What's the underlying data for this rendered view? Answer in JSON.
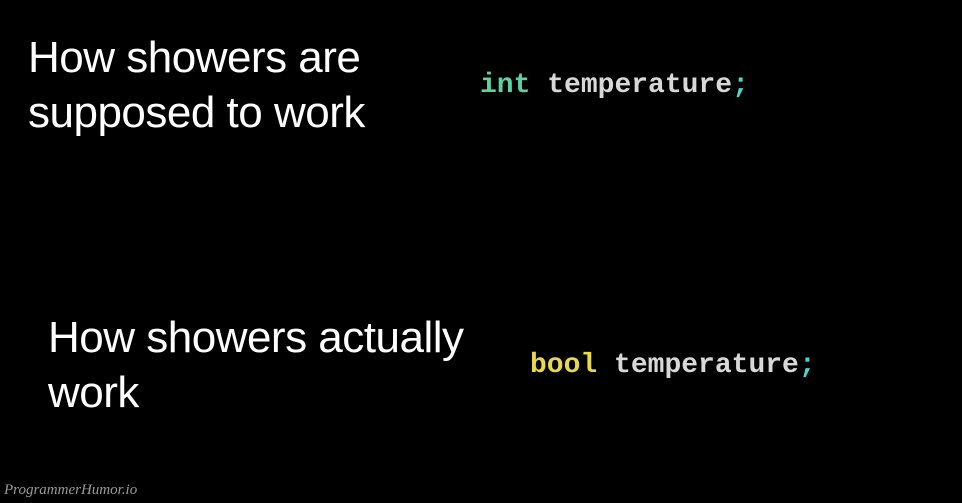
{
  "panels": {
    "top": {
      "caption": "How showers are supposed to work",
      "code": {
        "keyword": "int",
        "identifier": "temperature",
        "semicolon": ";"
      }
    },
    "bottom": {
      "caption": "How showers actually work",
      "code": {
        "keyword": "bool",
        "identifier": "temperature",
        "semicolon": ";"
      }
    }
  },
  "watermark": "ProgrammerHumor.io"
}
